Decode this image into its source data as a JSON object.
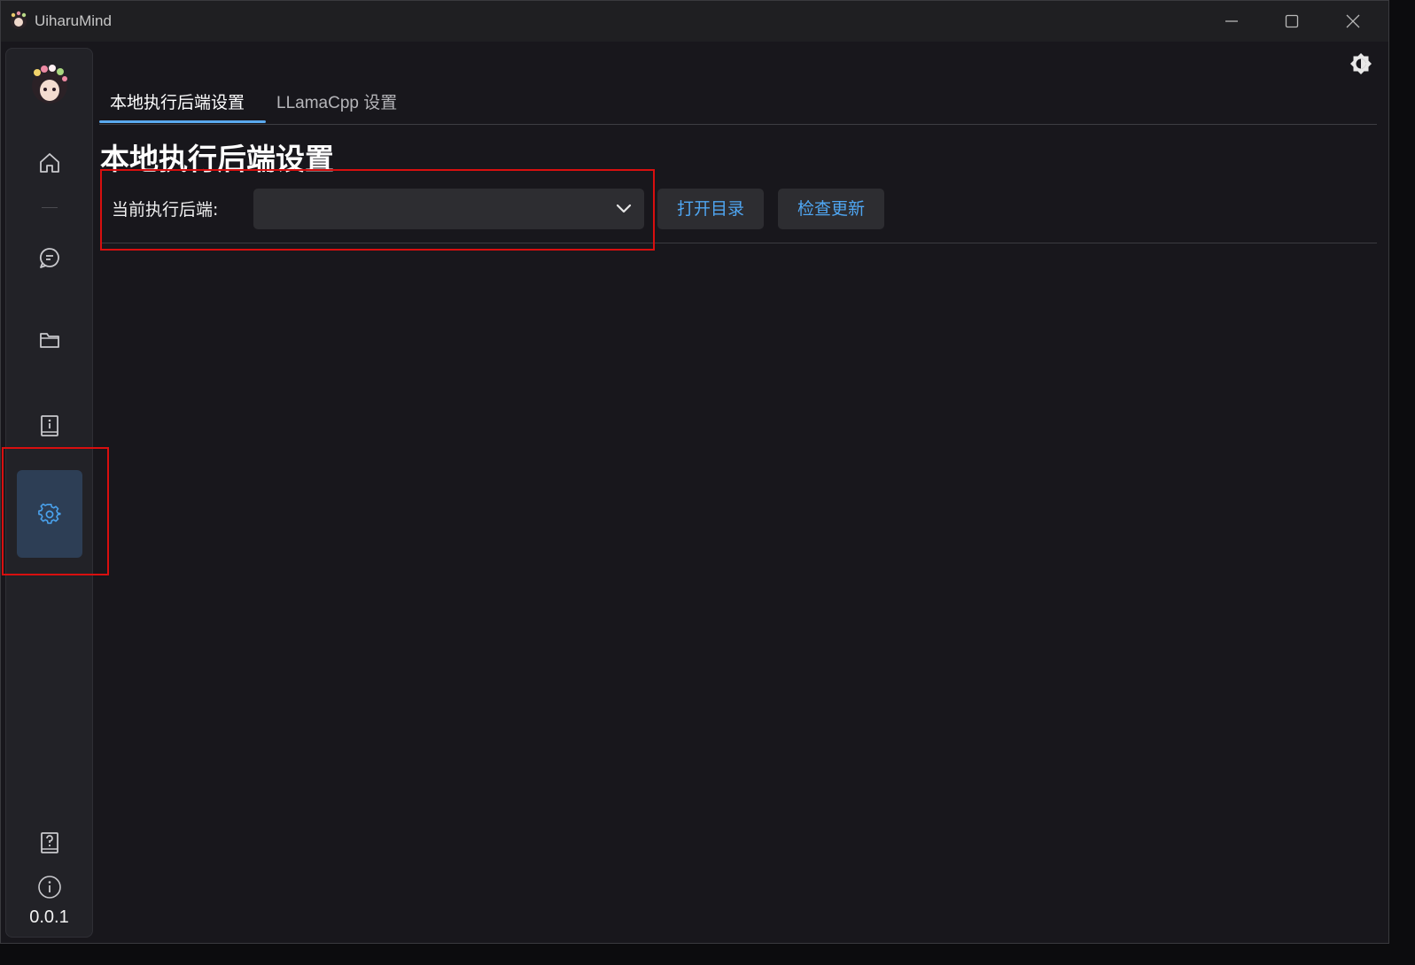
{
  "window": {
    "title": "UiharuMind",
    "controls": [
      "minimize-icon",
      "maximize-icon",
      "close-icon"
    ]
  },
  "sidebar": {
    "items": [
      {
        "icon": "home-icon"
      },
      {
        "icon": "chat-icon"
      },
      {
        "icon": "folder-icon"
      },
      {
        "icon": "info-book-icon"
      },
      {
        "icon": "gear-icon",
        "active": true
      }
    ],
    "footer": {
      "help_icon": "help-book-icon",
      "about_icon": "info-circle-icon",
      "version": "0.0.1"
    }
  },
  "tabs": [
    {
      "label": "本地执行后端设置",
      "active": true
    },
    {
      "label": "LLamaCpp 设置",
      "active": false
    }
  ],
  "page": {
    "title": "本地执行后端设置",
    "backend_label": "当前执行后端:",
    "backend_value": "",
    "open_dir_label": "打开目录",
    "check_update_label": "检查更新"
  },
  "colors": {
    "accent": "#5aa9ee",
    "highlight": "#d80f0f",
    "active_nav_bg": "#2d3e55"
  }
}
